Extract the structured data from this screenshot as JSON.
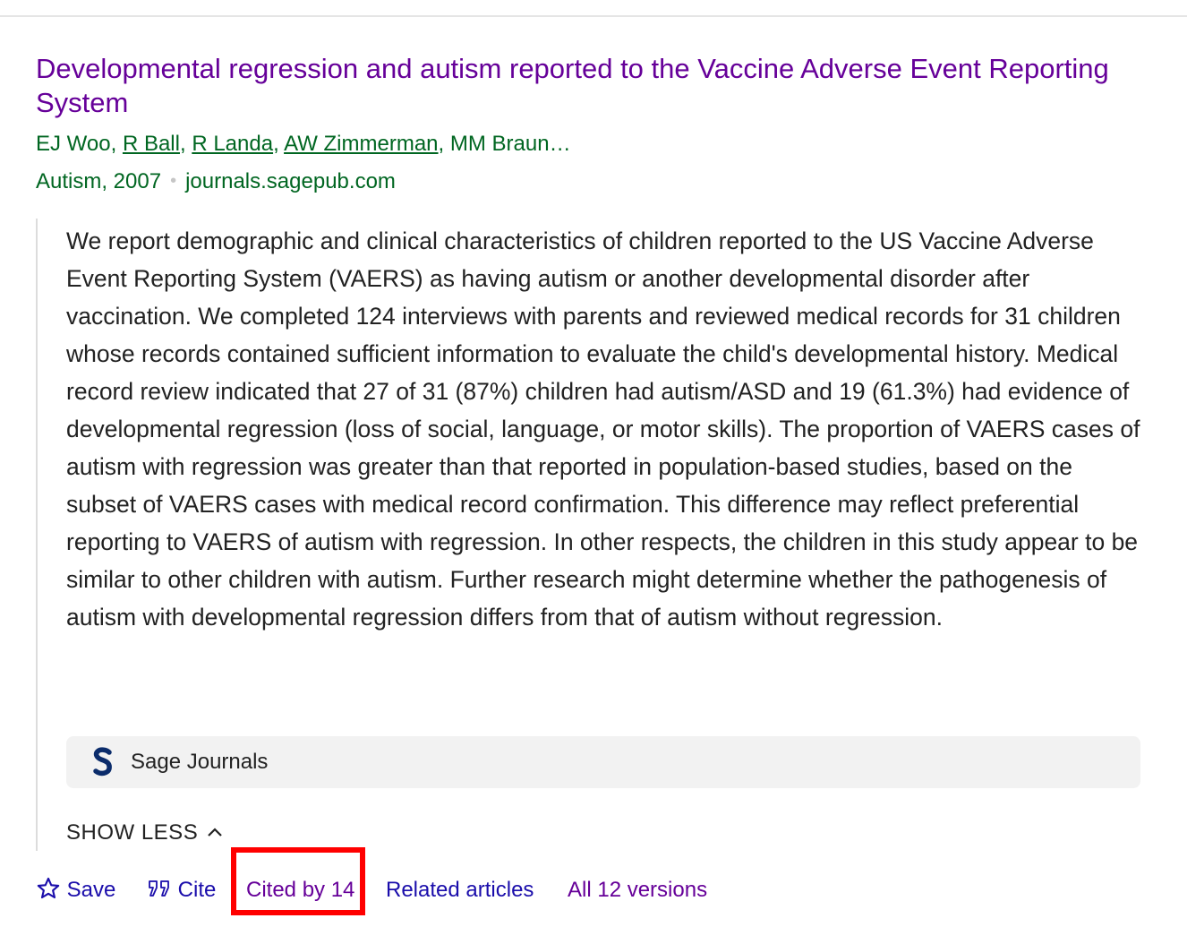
{
  "result": {
    "title": "Developmental regression and autism reported to the Vaccine Adverse Event Reporting System",
    "authors": [
      {
        "name": "EJ Woo",
        "linked": false
      },
      {
        "name": "R Ball",
        "linked": true
      },
      {
        "name": "R Landa",
        "linked": true
      },
      {
        "name": "AW Zimmerman",
        "linked": true
      },
      {
        "name": "MM Braun…",
        "linked": false
      }
    ],
    "separator": ", ",
    "venue_year": "Autism, 2007",
    "domain": "journals.sagepub.com",
    "meta_dot": "•",
    "abstract": "We report demographic and clinical characteristics of children reported to the US Vaccine Adverse Event Reporting System (VAERS) as having autism or another developmental disorder after vaccination. We completed 124 interviews with parents and reviewed medical records for 31 children whose records contained sufficient information to evaluate the child's developmental history. Medical record review indicated that 27 of 31 (87%) children had autism/ASD and 19 (61.3%) had evidence of developmental regression (loss of social, language, or motor skills). The proportion of VAERS cases of autism with regression was greater than that reported in population-based studies, based on the subset of VAERS cases with medical record confirmation. This difference may reflect preferential reporting to VAERS of autism with regression. In other respects, the children in this study appear to be similar to other children with autism. Further research might determine whether the pathogenesis of autism with developmental regression differs from that of autism without regression.",
    "source": {
      "name": "Sage Journals",
      "logo_icon": "sage-s-logo-icon",
      "logo_color": "#0b2c6b"
    },
    "show_less_label": "SHOW LESS"
  },
  "actions": {
    "save_label": "Save",
    "cite_label": "Cite",
    "cited_by_label": "Cited by 14",
    "related_label": "Related articles",
    "versions_label": "All 12 versions"
  },
  "colors": {
    "title_visited": "#660099",
    "link": "#1a0dab",
    "green_meta": "#006621",
    "highlight": "#ff0000"
  }
}
